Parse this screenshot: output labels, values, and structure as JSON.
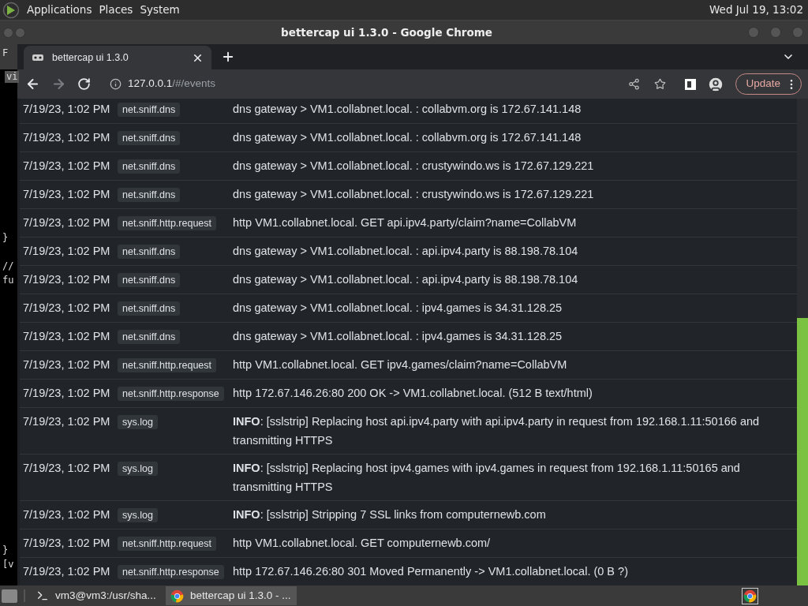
{
  "top_panel": {
    "menus": [
      "Applications",
      "Places",
      "System"
    ],
    "clock": "Wed Jul 19, 13:02"
  },
  "background_terminal": {
    "lines": [
      {
        "text": "F",
        "kind": "menu"
      },
      {
        "text": "vi",
        "kind": "tab"
      },
      {
        "text": "}",
        "kind": "code"
      },
      {
        "text": "//",
        "kind": "code"
      },
      {
        "text": "fu",
        "kind": "code"
      },
      {
        "text": "}",
        "kind": "code"
      },
      {
        "text": "[v",
        "kind": "code"
      }
    ]
  },
  "window": {
    "title": "bettercap ui 1.3.0 - Google Chrome"
  },
  "tabs": [
    {
      "label": "bettercap ui 1.3.0",
      "selected": true
    }
  ],
  "address_bar": {
    "host": "127.0.0.1",
    "path": "/#/events"
  },
  "update_button": "Update",
  "events": [
    {
      "time": "7/19/23, 1:02 PM",
      "tag": "net.sniff.dns",
      "message": "dns gateway > VM1.collabnet.local. : collabvm.org is 172.67.141.148"
    },
    {
      "time": "7/19/23, 1:02 PM",
      "tag": "net.sniff.dns",
      "message": "dns gateway > VM1.collabnet.local. : collabvm.org is 172.67.141.148"
    },
    {
      "time": "7/19/23, 1:02 PM",
      "tag": "net.sniff.dns",
      "message": "dns gateway > VM1.collabnet.local. : crustywindo.ws is 172.67.129.221"
    },
    {
      "time": "7/19/23, 1:02 PM",
      "tag": "net.sniff.dns",
      "message": "dns gateway > VM1.collabnet.local. : crustywindo.ws is 172.67.129.221"
    },
    {
      "time": "7/19/23, 1:02 PM",
      "tag": "net.sniff.http.request",
      "message": "http VM1.collabnet.local. GET api.ipv4.party/claim?name=CollabVM"
    },
    {
      "time": "7/19/23, 1:02 PM",
      "tag": "net.sniff.dns",
      "message": "dns gateway > VM1.collabnet.local. : api.ipv4.party is 88.198.78.104"
    },
    {
      "time": "7/19/23, 1:02 PM",
      "tag": "net.sniff.dns",
      "message": "dns gateway > VM1.collabnet.local. : api.ipv4.party is 88.198.78.104"
    },
    {
      "time": "7/19/23, 1:02 PM",
      "tag": "net.sniff.dns",
      "message": "dns gateway > VM1.collabnet.local. : ipv4.games is 34.31.128.25"
    },
    {
      "time": "7/19/23, 1:02 PM",
      "tag": "net.sniff.dns",
      "message": "dns gateway > VM1.collabnet.local. : ipv4.games is 34.31.128.25"
    },
    {
      "time": "7/19/23, 1:02 PM",
      "tag": "net.sniff.http.request",
      "message": "http VM1.collabnet.local. GET ipv4.games/claim?name=CollabVM"
    },
    {
      "time": "7/19/23, 1:02 PM",
      "tag": "net.sniff.http.response",
      "message": "http 172.67.146.26:80 200 OK -> VM1.collabnet.local. (512 B text/html)"
    },
    {
      "time": "7/19/23, 1:02 PM",
      "tag": "sys.log",
      "message": "**INFO**: [sslstrip] Replacing host api.ipv4.party with api.ipv4.party in request from 192.168.1.11:50166 and transmitting HTTPS"
    },
    {
      "time": "7/19/23, 1:02 PM",
      "tag": "sys.log",
      "message": "**INFO**: [sslstrip] Replacing host ipv4.games with ipv4.games in request from 192.168.1.11:50165 and transmitting HTTPS"
    },
    {
      "time": "7/19/23, 1:02 PM",
      "tag": "sys.log",
      "message": "**INFO**: [sslstrip] Stripping 7 SSL links from computernewb.com"
    },
    {
      "time": "7/19/23, 1:02 PM",
      "tag": "net.sniff.http.request",
      "message": "http VM1.collabnet.local. GET computernewb.com/"
    },
    {
      "time": "7/19/23, 1:02 PM",
      "tag": "net.sniff.http.response",
      "message": "http 172.67.146.26:80 301 Moved Permanently -> VM1.collabnet.local. (0 B ?)"
    }
  ],
  "taskbar": [
    {
      "label": "vm3@vm3:/usr/sha...",
      "kind": "terminal",
      "selected": false
    },
    {
      "label": "bettercap ui 1.3.0 - ...",
      "kind": "browser",
      "selected": true
    }
  ]
}
